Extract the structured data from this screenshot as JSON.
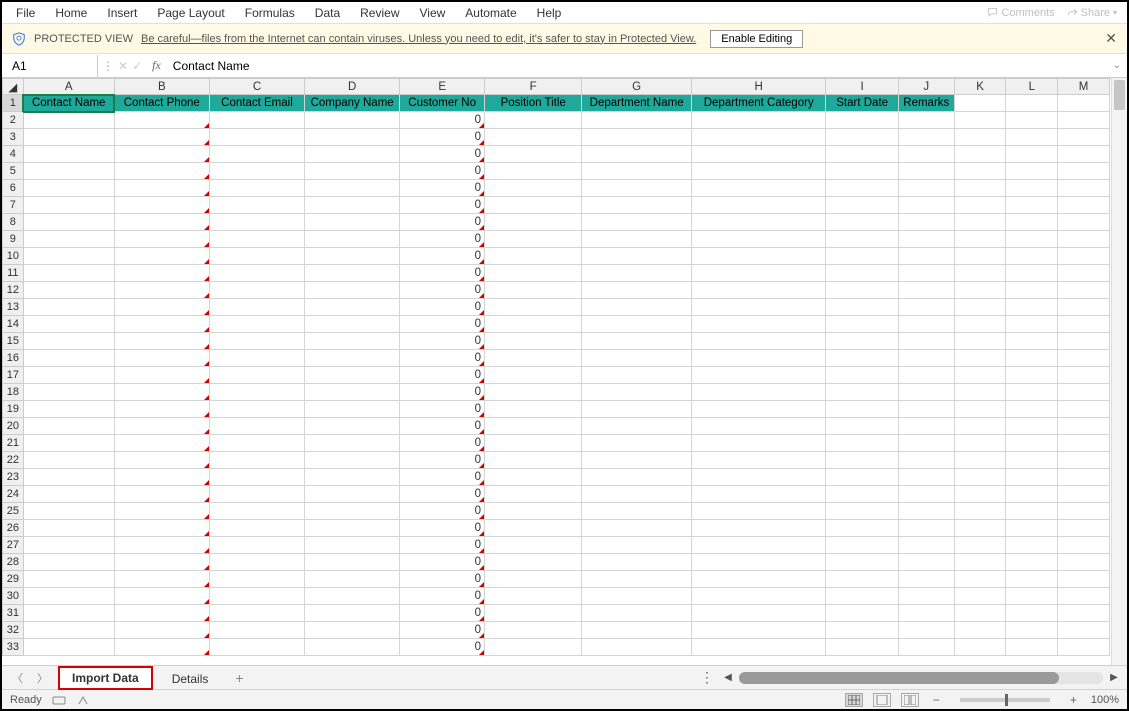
{
  "menu": {
    "items": [
      "File",
      "Home",
      "Insert",
      "Page Layout",
      "Formulas",
      "Data",
      "Review",
      "View",
      "Automate",
      "Help"
    ],
    "comments_label": "Comments",
    "share_label": "Share"
  },
  "protected_view": {
    "label": "PROTECTED VIEW",
    "message": "Be careful—files from the Internet can contain viruses. Unless you need to edit, it's safer to stay in Protected View.",
    "enable_label": "Enable Editing"
  },
  "namebox": {
    "value": "A1"
  },
  "formula": {
    "value": "Contact Name"
  },
  "columns": [
    "A",
    "B",
    "C",
    "D",
    "E",
    "F",
    "G",
    "H",
    "I",
    "J",
    "K",
    "L",
    "M"
  ],
  "header_row": {
    "A": "Contact Name",
    "B": "Contact Phone",
    "C": "Contact Email",
    "D": "Company Name",
    "E": "Customer No",
    "F": "Position Title",
    "G": "Department Name",
    "H": "Department Category",
    "I": "Start Date",
    "J": "Remarks"
  },
  "data_rows": {
    "count": 32,
    "colE_value": "0"
  },
  "tabs": {
    "active": "Import Data",
    "others": [
      "Details"
    ]
  },
  "status": {
    "ready": "Ready",
    "zoom": "100%"
  }
}
